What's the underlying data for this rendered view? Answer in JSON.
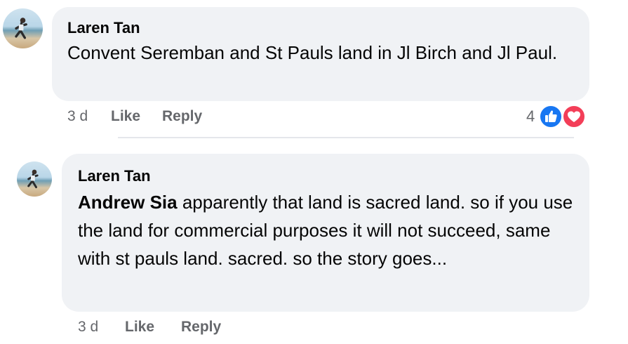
{
  "comments": [
    {
      "author": "Laren Tan",
      "text": "Convent Seremban and St Pauls land in Jl Birch and Jl Paul.",
      "time": "3 d",
      "like_label": "Like",
      "reply_label": "Reply",
      "reaction_count": "4",
      "reactions": [
        "like-reaction-icon",
        "love-reaction-icon"
      ]
    },
    {
      "author": "Laren Tan",
      "mention": "Andrew Sia",
      "text": " apparently that land is sacred land. so if you use the land for commercial purposes it will not succeed, same with st pauls land. sacred. so the story goes...",
      "time": "3 d",
      "like_label": "Like",
      "reply_label": "Reply"
    }
  ],
  "colors": {
    "bubble": "#f0f2f5",
    "meta_text": "#65676b",
    "like_blue": "#1877f2",
    "love_red": "#f33e58"
  }
}
